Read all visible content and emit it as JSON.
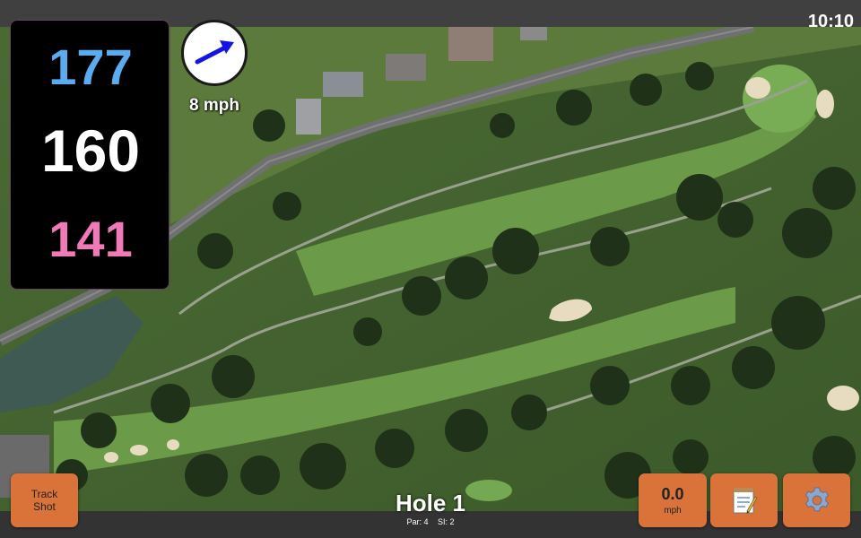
{
  "status_bar": {
    "time": "10:10"
  },
  "distances": {
    "back": "177",
    "middle": "160",
    "front": "141",
    "colors": {
      "back": "#5aabf0",
      "middle": "#ffffff",
      "front": "#f07ab8"
    }
  },
  "wind": {
    "speed": "8 mph",
    "direction_icon": "wind-arrow-icon"
  },
  "hole": {
    "title": "Hole 1",
    "par_label": "Par: 4",
    "si_label": "SI: 2"
  },
  "buttons": {
    "track_shot": "Track\nShot",
    "speed_value": "0.0",
    "speed_unit": "mph",
    "notes_icon": "notepad-icon",
    "settings_icon": "gear-icon"
  },
  "colors": {
    "button": "#d9733a",
    "panel_border": "#6a3f5f"
  }
}
